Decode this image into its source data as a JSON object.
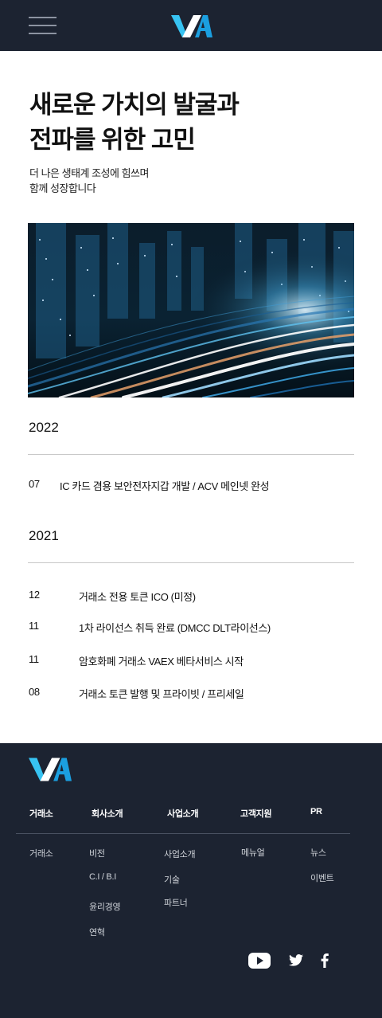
{
  "header": {
    "menu_icon": "hamburger-menu-icon",
    "logo_icon": "va-logo-icon",
    "brand_colors": {
      "dark": "#1c2331",
      "cyan": "#37c3f2",
      "blue": "#1b9fe0"
    }
  },
  "hero": {
    "title_line1": "새로운 가치의 발굴과",
    "title_line2": "전파를 위한 고민",
    "subtitle_line1": "더 나은 생태계 조성에 힘쓰며",
    "subtitle_line2": "함께 성장합니다"
  },
  "history": [
    {
      "year": "2022",
      "entries": [
        {
          "month": "07",
          "text": "IC 카드 겸용 보안전자지갑 개발 / ACV 메인넷 완성"
        }
      ]
    },
    {
      "year": "2021",
      "entries": [
        {
          "month": "12",
          "text": "거래소 전용 토큰 ICO (미정)"
        },
        {
          "month": "11",
          "text": "1차 라이선스 취득 완료 (DMCC DLT라이선스)"
        },
        {
          "month": "11",
          "text": "암호화폐 거래소 VAEX 베타서비스 시작"
        },
        {
          "month": "08",
          "text": "거래소 토큰 발행 및 프라이빗 / 프리세일"
        }
      ]
    }
  ],
  "footer": {
    "columns": [
      {
        "heading": "거래소",
        "links": [
          "거래소"
        ]
      },
      {
        "heading": "회사소개",
        "links": [
          "비전",
          "C.I / B.I",
          "윤리경영",
          "연혁"
        ]
      },
      {
        "heading": "사업소개",
        "links": [
          "사업소개",
          "기술",
          "파트너"
        ]
      },
      {
        "heading": "고객지원",
        "links": [
          "메뉴얼"
        ]
      },
      {
        "heading": "PR",
        "links": [
          "뉴스",
          "이벤트"
        ]
      }
    ],
    "social_icons": [
      "youtube-icon",
      "twitter-icon",
      "facebook-icon"
    ]
  }
}
